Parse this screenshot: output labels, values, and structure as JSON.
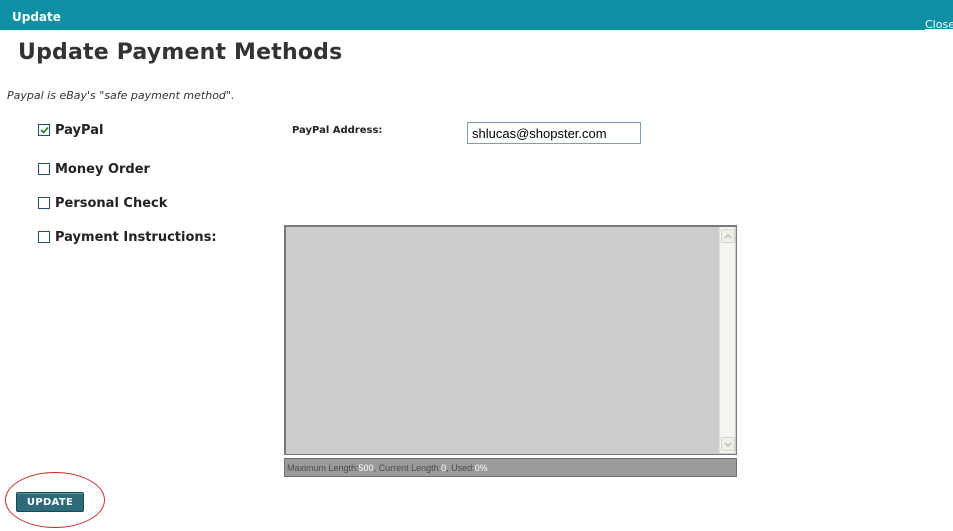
{
  "window": {
    "title": "Update",
    "close_label": "Close"
  },
  "page": {
    "title": "Update Payment Methods",
    "subtitle": "Paypal is eBay's \"safe payment method\"."
  },
  "payment_options": [
    {
      "label": "PayPal",
      "checked": true
    },
    {
      "label": "Money Order",
      "checked": false
    },
    {
      "label": "Personal Check",
      "checked": false
    },
    {
      "label": "Payment Instructions:",
      "checked": false
    }
  ],
  "paypal": {
    "address_label": "PayPal Address:",
    "address_value": "shlucas@shopster.com"
  },
  "instructions": {
    "value": "",
    "counter": {
      "max_label": "Maximum Length: ",
      "max_value": "500",
      "current_label": ", Current Length: ",
      "current_value": "0",
      "used_label": ", Used: ",
      "used_value": "0%"
    }
  },
  "actions": {
    "update_label": "UPDATE"
  },
  "colors": {
    "titlebar": "#0f8fa3",
    "button": "#2e6a78",
    "annotation": "#d62a2a"
  },
  "icons": {
    "checkbox_checked": "checkmark-icon",
    "scroll_up": "chevron-up-icon",
    "scroll_down": "chevron-down-icon"
  }
}
